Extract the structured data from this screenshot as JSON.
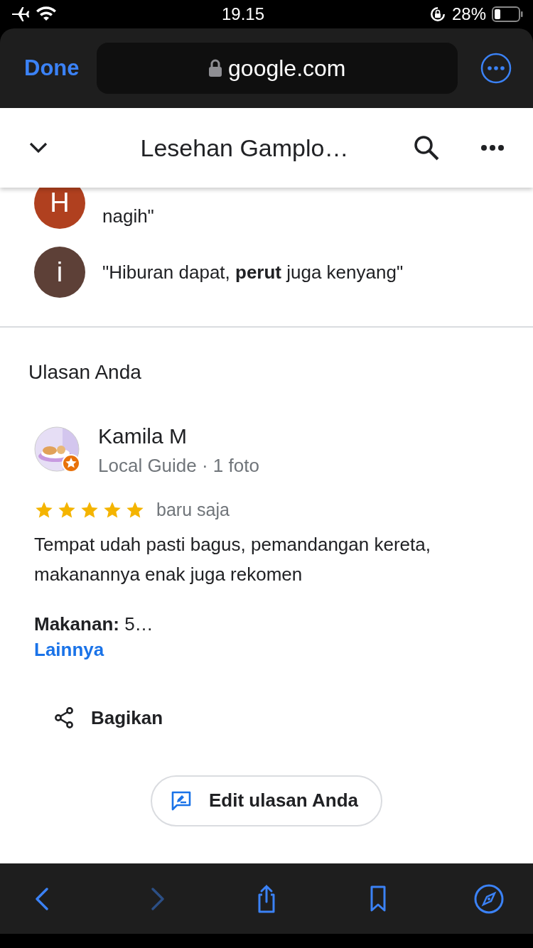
{
  "status_bar": {
    "time": "19.15",
    "battery": "28%"
  },
  "browser": {
    "done": "Done",
    "url": "google.com"
  },
  "header": {
    "title": "Lesehan Gamplo…"
  },
  "snippets": [
    {
      "initial": "H",
      "color": "#b0401f",
      "text": "nagih\"",
      "cut_top": true
    },
    {
      "initial": "i",
      "color": "#5d4037",
      "text": "\"Hiburan dapat, **perut** juga kenyang\""
    }
  ],
  "your_review": {
    "heading": "Ulasan Anda",
    "name": "Kamila M",
    "subtitle": "Local Guide · 1 foto",
    "stars": 5,
    "time": "baru saja",
    "text": "Tempat udah pasti bagus, pemandangan kereta, makanannya enak juga rekomen",
    "detail": "**Makanan:** 5…",
    "more": "Lainnya",
    "share": "Bagikan",
    "edit": "Edit ulasan Anda"
  },
  "toolbar": [
    {
      "kind": "back",
      "disabled": false
    },
    {
      "kind": "forward",
      "disabled": true
    },
    {
      "kind": "share",
      "disabled": false
    },
    {
      "kind": "bookmarks",
      "disabled": false
    },
    {
      "kind": "compass",
      "disabled": false
    }
  ]
}
